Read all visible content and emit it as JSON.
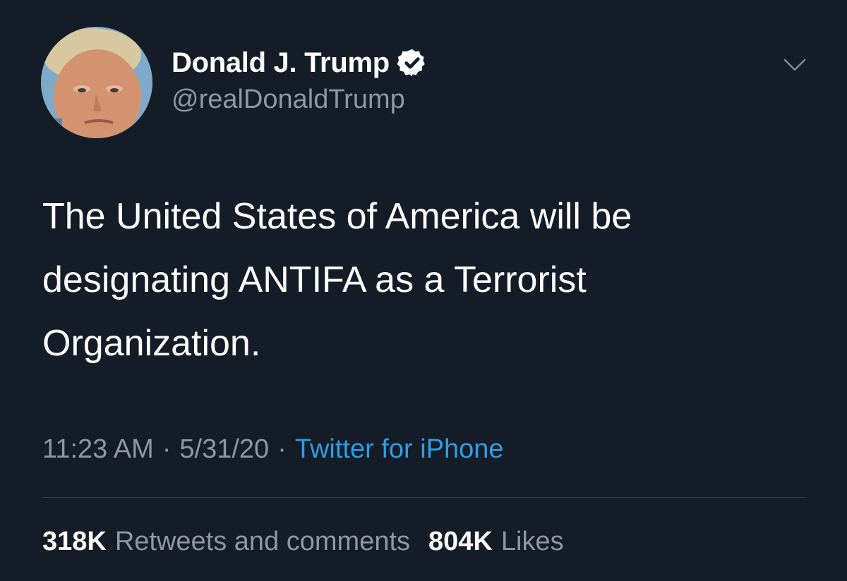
{
  "author": {
    "name": "Donald J. Trump",
    "handle": "@realDonaldTrump",
    "verified": true
  },
  "tweet": {
    "text_lines": [
      "The United States of America will be",
      "designating ANTIFA as a Terrorist",
      "Organization."
    ],
    "time": "11:23 AM",
    "date": "5/31/20",
    "separator": "·",
    "source": "Twitter for iPhone"
  },
  "stats": {
    "retweets_count": "318K",
    "retweets_label": "Retweets and comments",
    "likes_count": "804K",
    "likes_label": "Likes"
  },
  "icons": {
    "verified": "verified-badge-icon",
    "more": "chevron-down-icon"
  },
  "colors": {
    "background": "#141c27",
    "text": "#ffffff",
    "secondary": "#8b98a5",
    "link": "#2f9de4",
    "divider": "#2f3b48"
  }
}
